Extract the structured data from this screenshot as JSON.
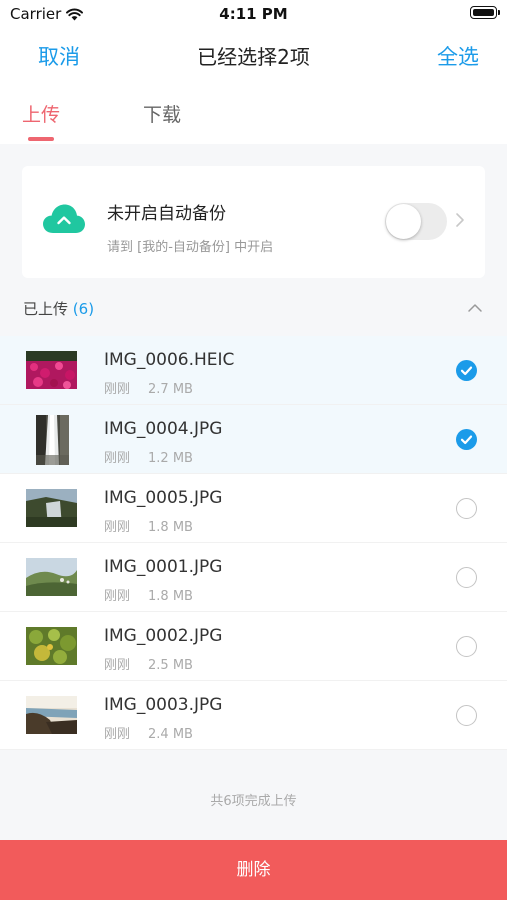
{
  "status_bar": {
    "carrier": "Carrier",
    "time": "4:11 PM"
  },
  "nav": {
    "cancel_label": "取消",
    "title": "已经选择2项",
    "select_all_label": "全选"
  },
  "tabs": [
    {
      "label": "上传",
      "active": true
    },
    {
      "label": "下载",
      "active": false
    }
  ],
  "backup": {
    "title": "未开启自动备份",
    "subtitle": "请到 [我的-自动备份] 中开启",
    "enabled": false
  },
  "section": {
    "title": "已上传",
    "count": "(6)"
  },
  "files": [
    {
      "name": "IMG_0006.HEIC",
      "time": "刚刚",
      "size": "2.7 MB",
      "selected": true,
      "thumb": "flowers-thumbnail"
    },
    {
      "name": "IMG_0004.JPG",
      "time": "刚刚",
      "size": "1.2 MB",
      "selected": true,
      "thumb": "waterfall-thumbnail"
    },
    {
      "name": "IMG_0005.JPG",
      "time": "刚刚",
      "size": "1.8 MB",
      "selected": false,
      "thumb": "cliff-thumbnail"
    },
    {
      "name": "IMG_0001.JPG",
      "time": "刚刚",
      "size": "1.8 MB",
      "selected": false,
      "thumb": "hillside-thumbnail"
    },
    {
      "name": "IMG_0002.JPG",
      "time": "刚刚",
      "size": "2.5 MB",
      "selected": false,
      "thumb": "leaves-thumbnail"
    },
    {
      "name": "IMG_0003.JPG",
      "time": "刚刚",
      "size": "2.4 MB",
      "selected": false,
      "thumb": "coast-thumbnail"
    }
  ],
  "footer_note": "共6项完成上传",
  "delete_label": "删除",
  "colors": {
    "accent_blue": "#1b9be9",
    "tab_red": "#ee6670",
    "delete_red": "#f25b5b",
    "cloud_green": "#20c7a0"
  }
}
